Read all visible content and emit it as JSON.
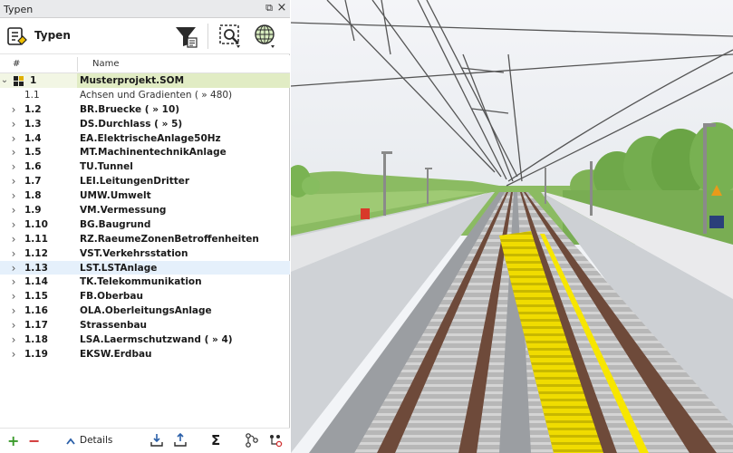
{
  "panel": {
    "title": "Typen",
    "float_glyph": "⧉",
    "close_glyph": "×",
    "toolbar_label": "Typen",
    "toolbar_icons": [
      "typen-icon",
      "filter-icon",
      "zoom-to-selection-icon",
      "globe-grid-icon"
    ]
  },
  "columns": {
    "number": "#",
    "name": "Name"
  },
  "tree": [
    {
      "num": "1",
      "name": "Musterprojekt.SOM",
      "expanded": true,
      "root": true
    },
    {
      "num": "1.1",
      "name": "Achsen und Gradienten ( » 480)",
      "plain": true
    },
    {
      "num": "1.2",
      "name": "BR.Bruecke ( » 10)"
    },
    {
      "num": "1.3",
      "name": "DS.Durchlass ( » 5)"
    },
    {
      "num": "1.4",
      "name": "EA.ElektrischeAnlage50Hz"
    },
    {
      "num": "1.5",
      "name": "MT.MachinentechnikAnlage"
    },
    {
      "num": "1.6",
      "name": "TU.Tunnel"
    },
    {
      "num": "1.7",
      "name": "LEI.LeitungenDritter"
    },
    {
      "num": "1.8",
      "name": "UMW.Umwelt"
    },
    {
      "num": "1.9",
      "name": "VM.Vermessung"
    },
    {
      "num": "1.10",
      "name": "BG.Baugrund"
    },
    {
      "num": "1.11",
      "name": "RZ.RaeumeZonenBetroffenheiten"
    },
    {
      "num": "1.12",
      "name": "VST.Verkehrsstation"
    },
    {
      "num": "1.13",
      "name": "LST.LSTAnlage",
      "selected": true
    },
    {
      "num": "1.14",
      "name": "TK.Telekommunikation"
    },
    {
      "num": "1.15",
      "name": "FB.Oberbau"
    },
    {
      "num": "1.16",
      "name": "OLA.OberleitungsAnlage"
    },
    {
      "num": "1.17",
      "name": "Strassenbau"
    },
    {
      "num": "1.18",
      "name": "LSA.Laermschutzwand ( » 4)"
    },
    {
      "num": "1.19",
      "name": "EKSW.Erdbau"
    }
  ],
  "footer": {
    "add_glyph": "+",
    "remove_glyph": "−",
    "details_label": "Details",
    "sum_glyph": "Σ",
    "icons": [
      "import-icon",
      "export-icon",
      "sum-icon",
      "hierarchy-icon",
      "settings-tree-icon"
    ]
  },
  "colors": {
    "platform_yellow": "#f2de00",
    "rail": "#6e4a3a",
    "ballast": "#9a9a9a",
    "tree_green": "#7fb256",
    "selection": "#e5f0fb"
  }
}
